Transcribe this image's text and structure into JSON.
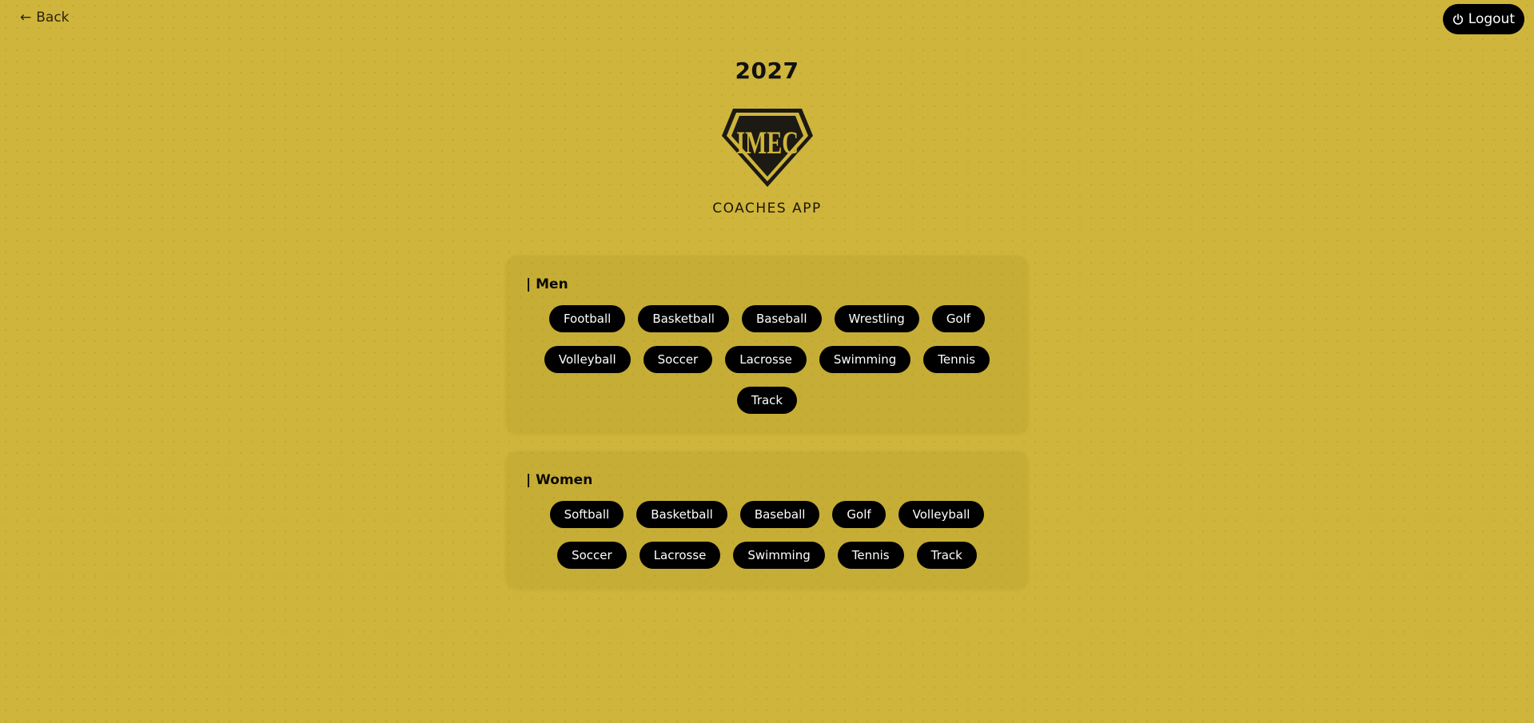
{
  "nav": {
    "back_label": "Back",
    "back_arrow": "←",
    "logout_label": "Logout"
  },
  "header": {
    "year": "2027",
    "logo_text": "IMEC",
    "subtitle": "COACHES APP"
  },
  "men": {
    "title": "| Men",
    "sports": [
      "Football",
      "Basketball",
      "Baseball",
      "Wrestling",
      "Golf",
      "Volleyball",
      "Soccer",
      "Lacrosse",
      "Swimming",
      "Tennis",
      "Track"
    ]
  },
  "women": {
    "title": "| Women",
    "sports": [
      "Softball",
      "Basketball",
      "Baseball",
      "Golf",
      "Volleyball",
      "Soccer",
      "Lacrosse",
      "Swimming",
      "Tennis",
      "Track"
    ]
  },
  "colors": {
    "background": "#cfb53b",
    "button": "#000000",
    "button_text": "#ffffff"
  },
  "icons": {
    "logout": "power-icon",
    "back": "arrow-left-icon"
  }
}
